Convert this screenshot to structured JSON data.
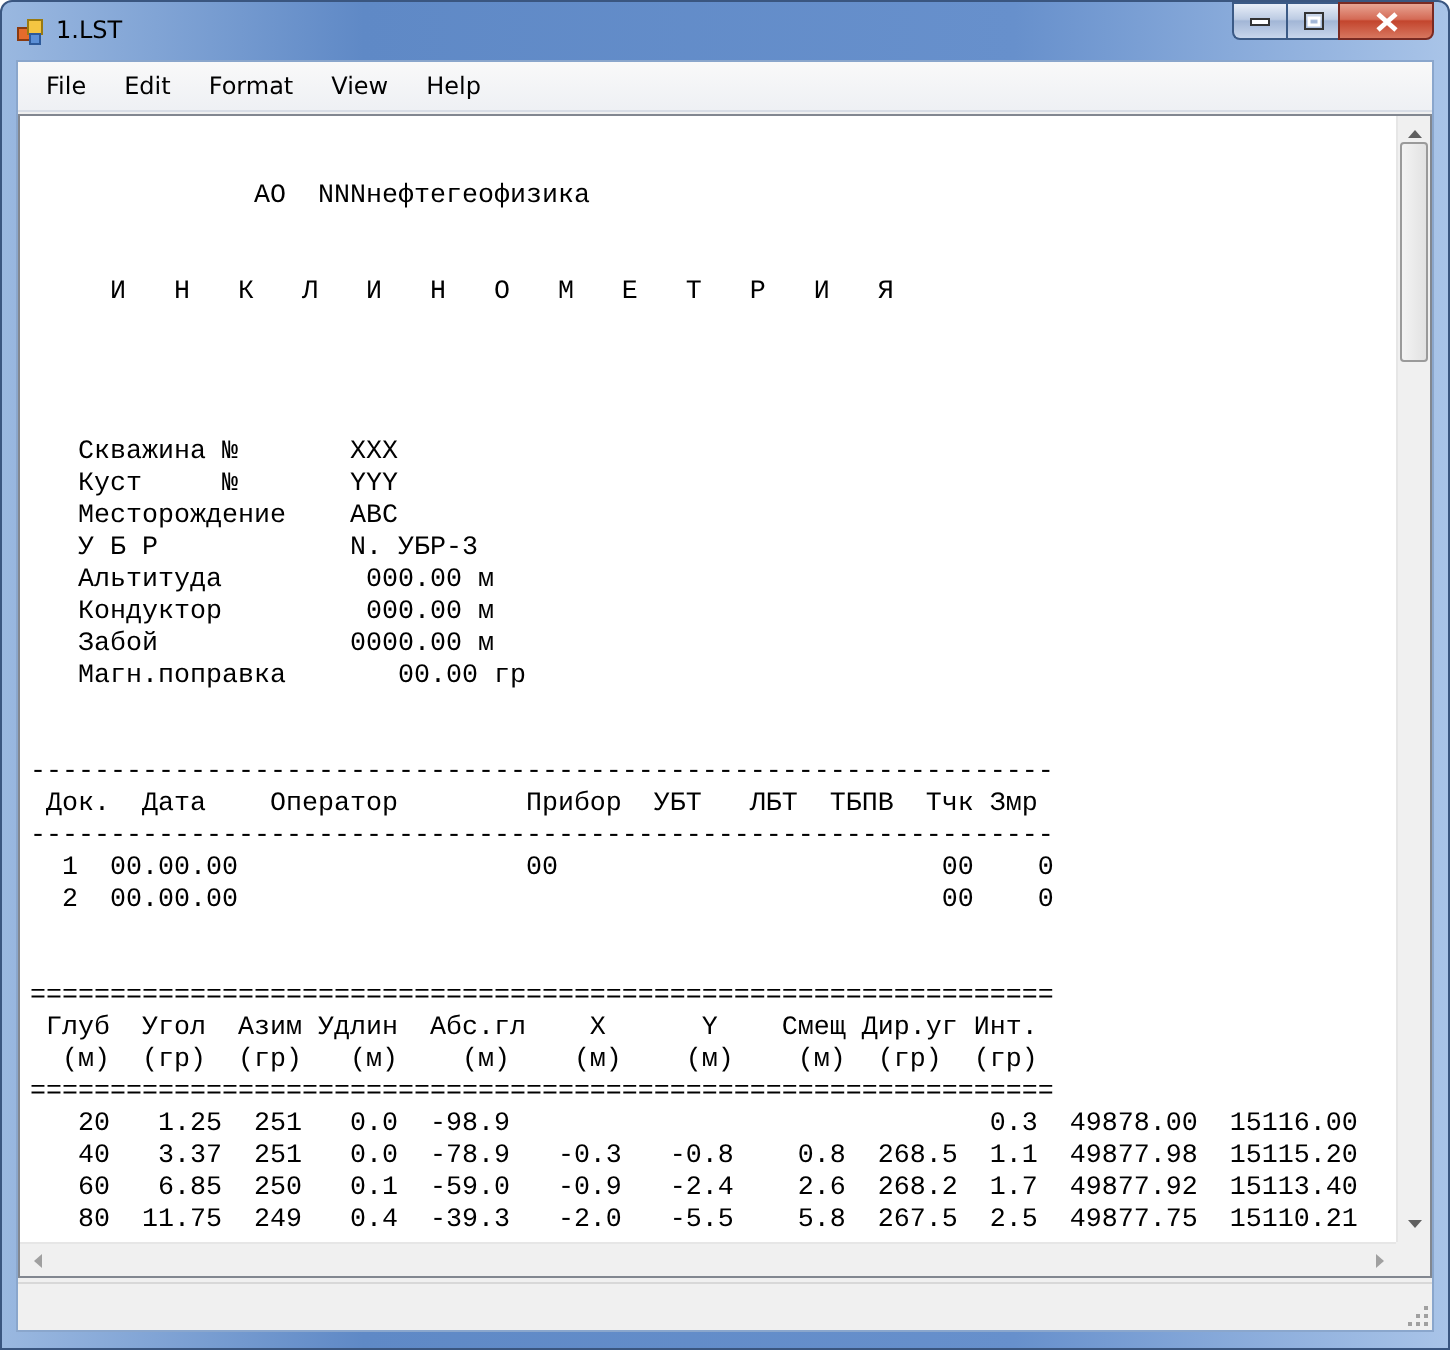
{
  "window": {
    "title": "1.LST"
  },
  "menu": [
    {
      "label": "File"
    },
    {
      "label": "Edit"
    },
    {
      "label": "Format"
    },
    {
      "label": "View"
    },
    {
      "label": "Help"
    }
  ],
  "document": {
    "lines": [
      {
        "kind": "blank"
      },
      {
        "kind": "blank"
      },
      {
        "kind": "text",
        "text": "              АО  NNNнефтегеофизика"
      },
      {
        "kind": "blank"
      },
      {
        "kind": "blank"
      },
      {
        "kind": "text",
        "text": "     И   Н   К   Л   И   Н   О   М   Е   Т   Р   И   Я"
      },
      {
        "kind": "blank"
      },
      {
        "kind": "blank"
      },
      {
        "kind": "blank"
      },
      {
        "kind": "blank"
      },
      {
        "kind": "text",
        "text": "   Скважина №       XXX"
      },
      {
        "kind": "text",
        "text": "   Куст     №       YYY"
      },
      {
        "kind": "text",
        "text": "   Месторождение    ABC"
      },
      {
        "kind": "text",
        "text": "   У Б Р            N. УБР-3"
      },
      {
        "kind": "text",
        "text": "   Альтитуда         000.00 м"
      },
      {
        "kind": "text",
        "text": "   Кондуктор         000.00 м"
      },
      {
        "kind": "text",
        "text": "   Забой            0000.00 м"
      },
      {
        "kind": "text",
        "text": "   Магн.поправка       00.00 гр"
      },
      {
        "kind": "blank"
      },
      {
        "kind": "blank"
      },
      {
        "kind": "text",
        "text": "----------------------------------------------------------------"
      },
      {
        "kind": "text",
        "text": " Док.  Дата    Оператор        Прибор  УБТ   ЛБТ  ТБПВ  Тчк Змр"
      },
      {
        "kind": "text",
        "text": "----------------------------------------------------------------"
      },
      {
        "kind": "text",
        "text": "  1  00.00.00                  00                        00    0"
      },
      {
        "kind": "text",
        "text": "  2  00.00.00                                            00    0"
      },
      {
        "kind": "blank"
      },
      {
        "kind": "blank"
      },
      {
        "kind": "text",
        "text": "================================================================"
      },
      {
        "kind": "text",
        "text": " Глуб  Угол  Азим Удлин  Абс.гл    X      Y    Смещ Дир.уг Инт."
      },
      {
        "kind": "text",
        "text": "  (м)  (гр)  (гр)   (м)    (м)    (м)    (м)    (м)  (гр)  (гр)"
      },
      {
        "kind": "text",
        "text": "================================================================"
      },
      {
        "kind": "text",
        "text": "   20   1.25  251   0.0  -98.9                              0.3  49878.00  15116.00"
      },
      {
        "kind": "text",
        "text": "   40   3.37  251   0.0  -78.9   -0.3   -0.8    0.8  268.5  1.1  49877.98  15115.20"
      },
      {
        "kind": "text",
        "text": "   60   6.85  250   0.1  -59.0   -0.9   -2.4    2.6  268.2  1.7  49877.92  15113.40"
      },
      {
        "kind": "text",
        "text": "   80  11.75  249   0.4  -39.3   -2.0   -5.5    5.8  267.5  2.5  49877.75  15110.21"
      }
    ]
  }
}
